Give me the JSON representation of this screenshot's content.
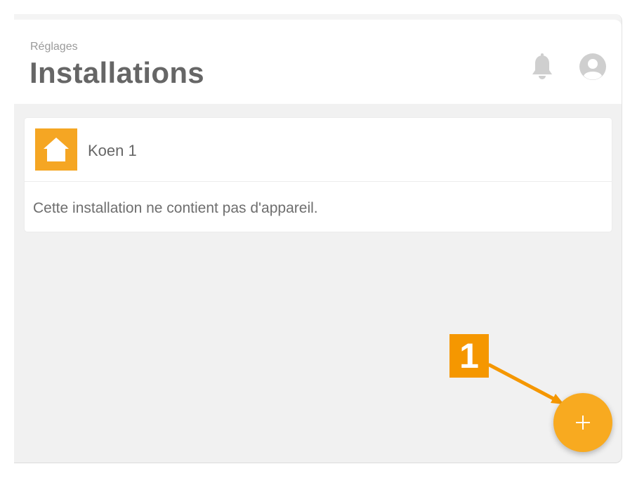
{
  "header": {
    "breadcrumb": "Réglages",
    "title": "Installations",
    "icons": [
      "bell-icon",
      "user-avatar-icon"
    ]
  },
  "installation": {
    "name": "Koen 1",
    "icon": "house-icon",
    "empty_message": "Cette installation ne contient pas d'appareil."
  },
  "annotation": {
    "badge_label": "1",
    "color": "#f59700"
  },
  "fab": {
    "icon": "plus-icon",
    "color": "#f8aa20"
  },
  "colors": {
    "accent": "#f5a623",
    "title": "#666666",
    "background": "#f1f1f1"
  }
}
